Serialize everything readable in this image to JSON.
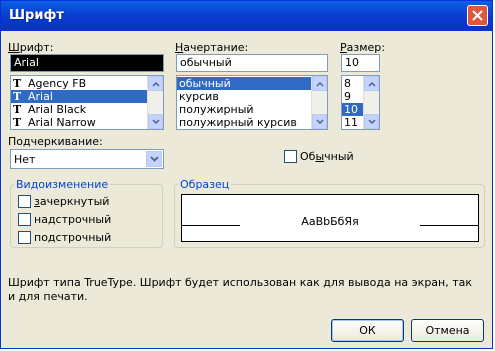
{
  "dialog": {
    "title": "Шрифт"
  },
  "font": {
    "label": "Шрифт:",
    "label_rest": "рифт:",
    "label_u": "Ш",
    "value": "Arial",
    "items": [
      "Agency FB",
      "Arial",
      "Arial Black",
      "Arial Narrow"
    ],
    "selected": "Arial"
  },
  "style": {
    "label": "Начертание:",
    "label_u": "Н",
    "label_rest": "ачертание:",
    "value": "обычный",
    "items": [
      "обычный",
      "курсив",
      "полужирный",
      "полужирный курсив"
    ],
    "selected": "обычный"
  },
  "size": {
    "label": "Размер:",
    "label_u": "Р",
    "label_rest": "азмер:",
    "value": "10",
    "items": [
      "8",
      "9",
      "10",
      "11"
    ],
    "selected": "10"
  },
  "underline": {
    "label": "Подчеркивание:",
    "value": "Нет"
  },
  "normal": {
    "label": "Обычный",
    "label_u": "ы",
    "label_a": "Об",
    "label_b": "чный"
  },
  "effects": {
    "title": "Видоизменение",
    "items": [
      {
        "a": "",
        "u": "з",
        "b": "ачеркнутый"
      },
      {
        "a": "на",
        "u": "д",
        "b": "строчный"
      },
      {
        "a": "по",
        "u": "д",
        "b": "строчный"
      }
    ]
  },
  "preview": {
    "title": "Образец",
    "sample": "AaBbБбЯя"
  },
  "description": "Шрифт типа TrueType. Шрифт будет использован как для вывода на экран, так и для печати.",
  "buttons": {
    "ok": "ОК",
    "cancel": "Отмена"
  }
}
